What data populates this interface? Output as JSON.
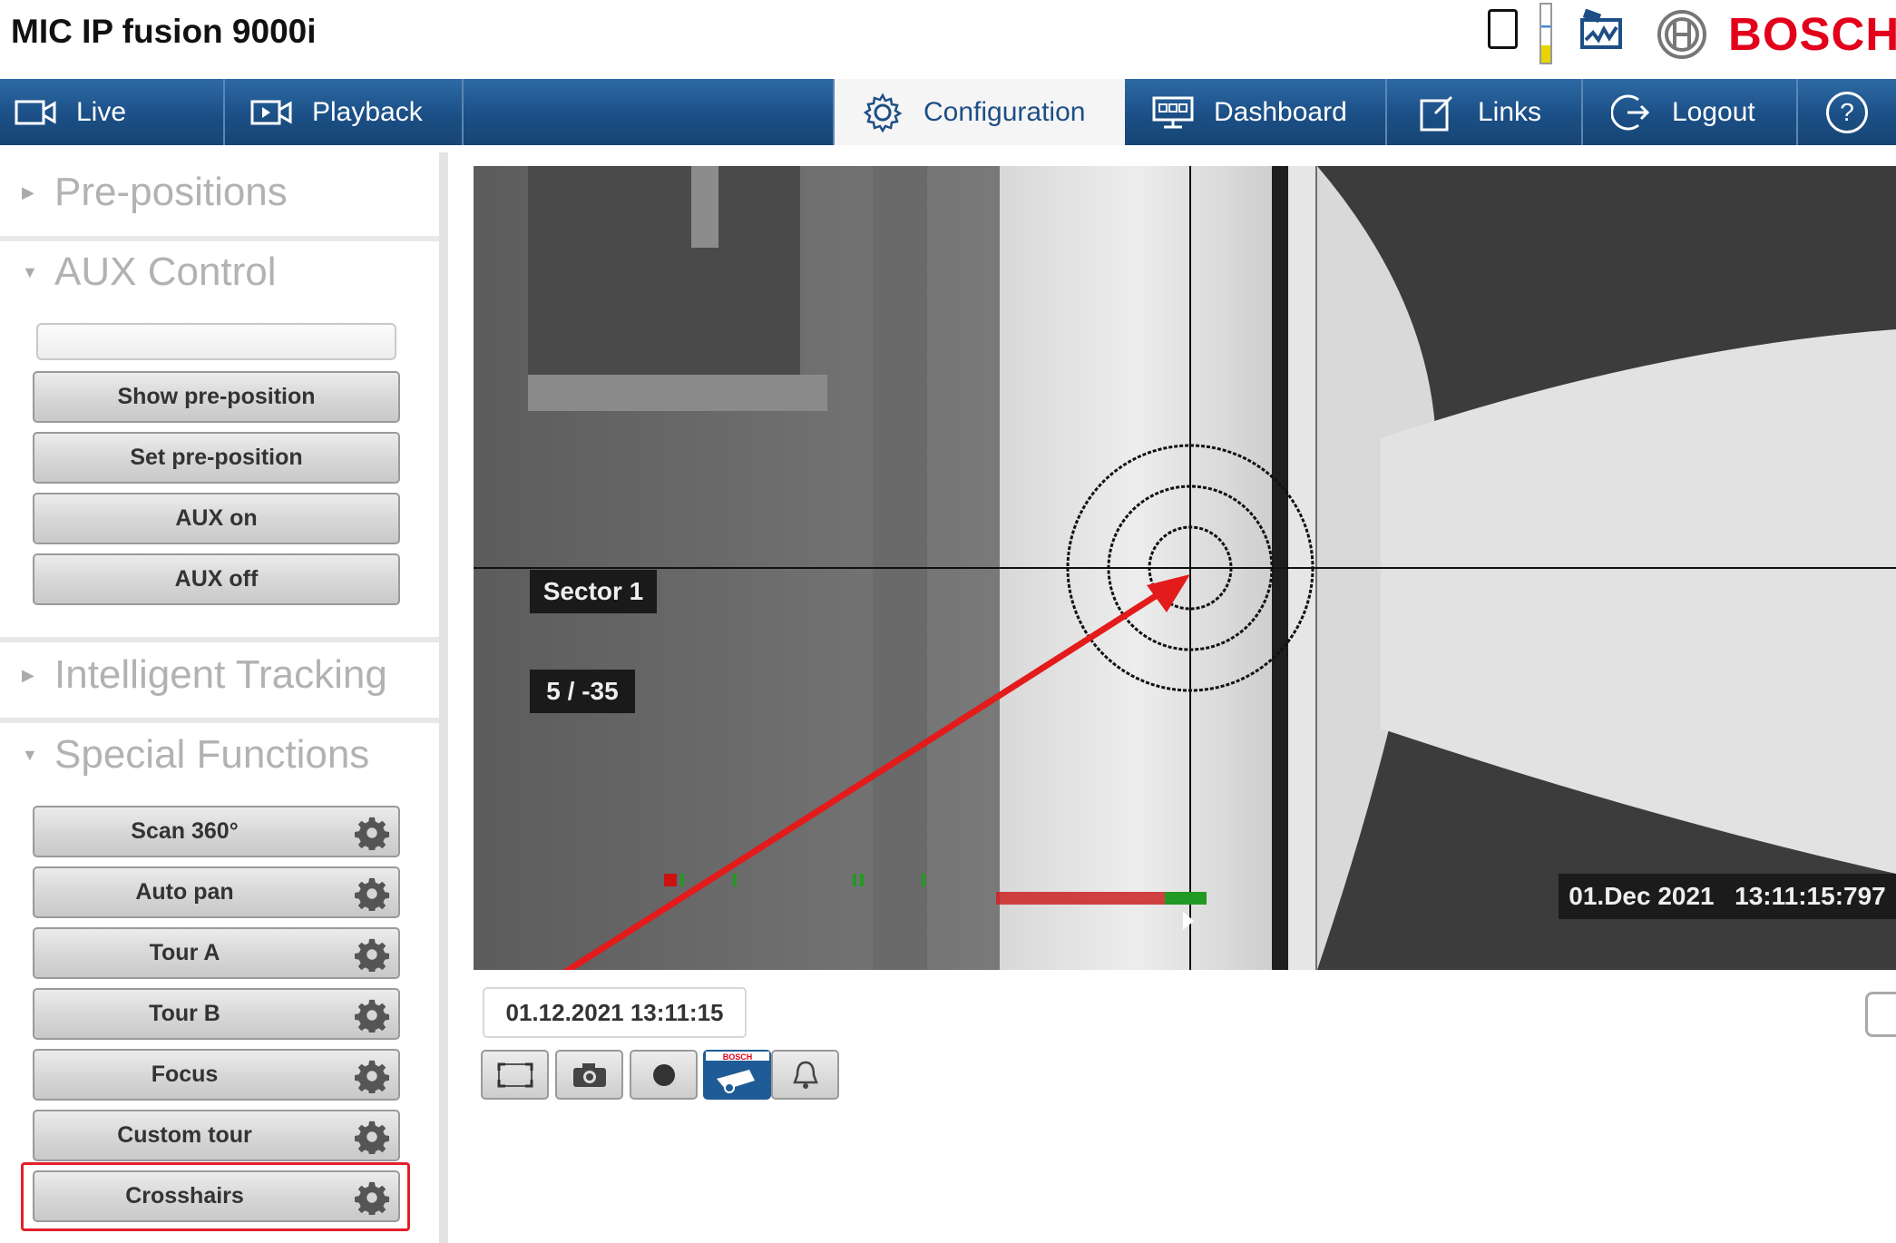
{
  "header": {
    "title": "MIC IP fusion 9000i",
    "brand": "BOSCH",
    "brand_color": "#e2001a",
    "icons": [
      "tablet-icon",
      "battery-level-icon",
      "camera-monitor-icon",
      "bosch-armature-icon"
    ]
  },
  "nav": {
    "live": "Live",
    "playback": "Playback",
    "configuration": "Configuration",
    "dashboard": "Dashboard",
    "links": "Links",
    "logout": "Logout",
    "help": "?",
    "active": "configuration",
    "bar_color": "#1b4f86"
  },
  "sidebar": {
    "sections": {
      "prepositions": "Pre-positions",
      "aux_control": "AUX Control",
      "intelligent_tracking": "Intelligent Tracking",
      "special_functions": "Special Functions"
    },
    "aux_input_value": "",
    "aux_buttons": {
      "show_preposition": "Show pre-position",
      "set_preposition": "Set pre-position",
      "aux_on": "AUX on",
      "aux_off": "AUX off"
    },
    "special_buttons": {
      "scan360": "Scan 360°",
      "auto_pan": "Auto pan",
      "tour_a": "Tour A",
      "tour_b": "Tour B",
      "focus": "Focus",
      "custom_tour": "Custom tour",
      "crosshairs": "Crosshairs"
    },
    "highlighted": "Crosshairs"
  },
  "video": {
    "sector_label": "Sector 1",
    "position_label": "5 / -35",
    "overlay_date": "01.Dec 2021",
    "overlay_time": "13:11:15:797"
  },
  "controls": {
    "timestamp": "01.12.2021 13:11:15",
    "tools": [
      "fullscreen-icon",
      "snapshot-camera-icon",
      "record-icon",
      "bosch-ptz-icon",
      "alarm-bell-icon"
    ],
    "bosch_badge": "BOSCH"
  }
}
